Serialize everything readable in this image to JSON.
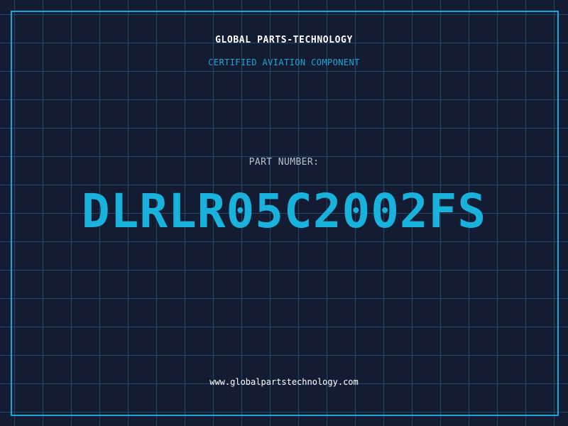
{
  "header": {
    "company": "GLOBAL PARTS-TECHNOLOGY",
    "subtitle": "CERTIFIED AVIATION COMPONENT"
  },
  "part": {
    "label": "PART NUMBER:",
    "number": "DLRLR05C2002FS"
  },
  "footer": {
    "url": "www.globalpartstechnology.com"
  },
  "colors": {
    "background": "#131c33",
    "grid": "#1e4a66",
    "accent": "#1aa8d6",
    "text": "#ffffff"
  }
}
